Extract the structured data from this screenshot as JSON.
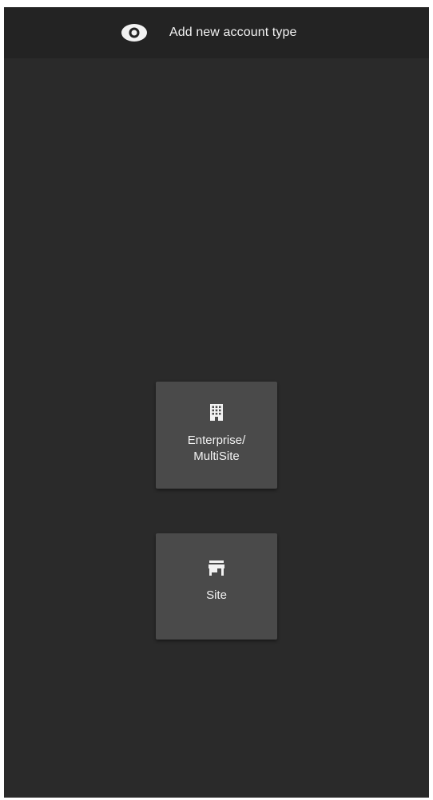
{
  "header": {
    "title": "Add new account type",
    "icon": "eye-icon"
  },
  "options": [
    {
      "label": "Enterprise/\nMultiSite",
      "icon": "building-icon"
    },
    {
      "label": "Site",
      "icon": "store-icon"
    }
  ],
  "colors": {
    "background": "#2a2a2a",
    "header_background": "#232323",
    "card_background": "#4a4a4a",
    "text": "#f2f2f2"
  }
}
